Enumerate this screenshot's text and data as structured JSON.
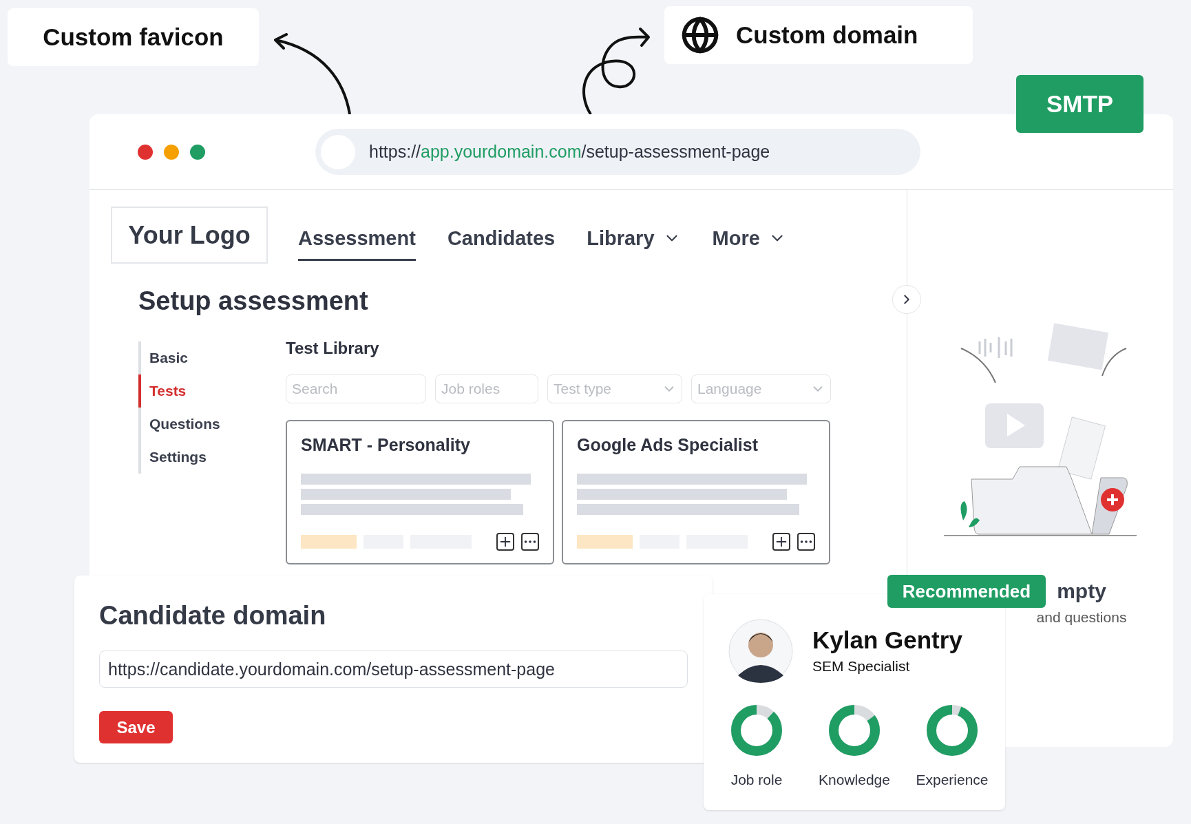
{
  "callouts": [
    {
      "kind": "favicon",
      "label": "Custom favicon"
    },
    {
      "kind": "domain",
      "label": "Custom domain"
    }
  ],
  "smtp_badge": "SMTP",
  "browser": {
    "url_prefix": "https://",
    "url_domain": "app.yourdomain.com",
    "url_path": "/setup-assessment-page"
  },
  "logo": "Your Logo",
  "nav": [
    {
      "label": "Assessment",
      "selected": true,
      "dropdown": false
    },
    {
      "label": "Candidates",
      "selected": false,
      "dropdown": false
    },
    {
      "label": "Library",
      "selected": false,
      "dropdown": true
    },
    {
      "label": "More",
      "selected": false,
      "dropdown": true
    }
  ],
  "page_title": "Setup assessment",
  "steps": [
    {
      "label": "Basic",
      "selected": false
    },
    {
      "label": "Tests",
      "selected": true
    },
    {
      "label": "Questions",
      "selected": false
    },
    {
      "label": "Settings",
      "selected": false
    }
  ],
  "library": {
    "title": "Test Library",
    "filters": [
      {
        "placeholder": "Search",
        "dropdown": false
      },
      {
        "placeholder": "Job roles",
        "dropdown": false
      },
      {
        "placeholder": "Test type",
        "dropdown": true
      },
      {
        "placeholder": "Language",
        "dropdown": true
      }
    ],
    "cards": [
      {
        "title": "SMART - Personality"
      },
      {
        "title": "Google Ads Specialist"
      }
    ]
  },
  "empty_panel": {
    "title": "mpty",
    "subtitle": "and questions"
  },
  "candidate_domain": {
    "title": "Candidate domain",
    "value": "https://candidate.yourdomain.com/setup-assessment-page",
    "save": "Save"
  },
  "profile": {
    "badge": "Recommended",
    "name": "Kylan Gentry",
    "role": "SEM Specialist",
    "scores": [
      {
        "label": "Job role",
        "level": 0.88
      },
      {
        "label": "Knowledge",
        "level": 0.85
      },
      {
        "label": "Experience",
        "level": 0.94
      }
    ]
  }
}
